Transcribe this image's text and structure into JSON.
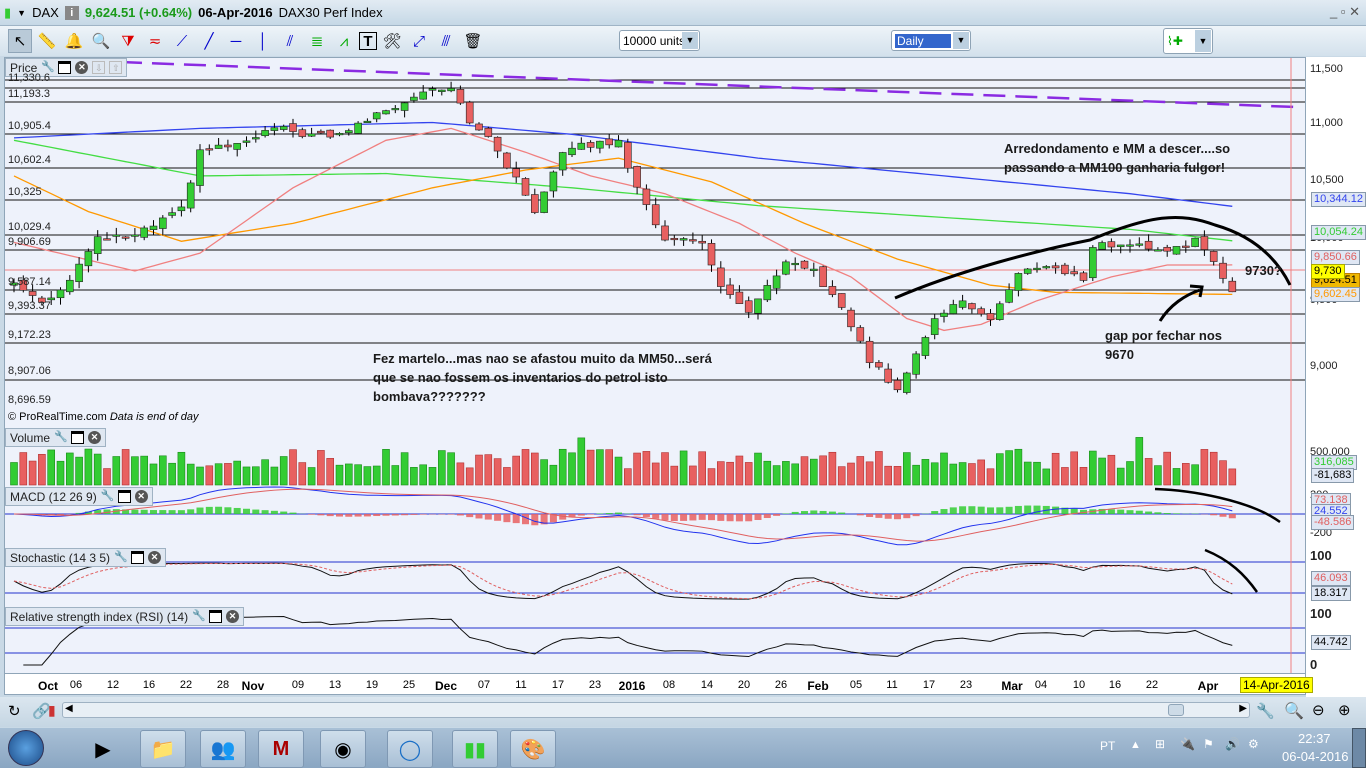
{
  "titlebar": {
    "symbol": "DAX",
    "price_change": "9,624.51 (+0.64%)",
    "date": "06-Apr-2016",
    "instrument": "DAX30 Perf Index",
    "window_controls": [
      "minimize",
      "restore",
      "close"
    ]
  },
  "toolbar": {
    "units": "10000 units",
    "timeframe": "Daily",
    "tools": [
      "pointer-icon",
      "ruler-icon",
      "alarm-icon",
      "zoom-icon",
      "triangle-pattern-icon",
      "channel-icon",
      "segment-icon",
      "line-icon",
      "horizontal-line-icon",
      "vertical-line-icon",
      "parallel-lines-icon",
      "fibonacci-icon",
      "trend-channel-icon",
      "text-icon",
      "tools-icon",
      "ray-icon",
      "parallel-ray-icon",
      "trash-icon"
    ]
  },
  "panes": {
    "price": {
      "label": "Price",
      "levels": [
        "11,330.6",
        "11,193.3",
        "10,905.4",
        "10,602.4",
        "10,325",
        "10,029.4",
        "9,906.69",
        "9,587.14",
        "9,393.37",
        "9,172.23",
        "8,907.06",
        "8,696.59"
      ],
      "axis": [
        "11,500",
        "11,000",
        "10,500",
        "10,000",
        "9,500",
        "9,000"
      ],
      "tags": {
        "ma200": "10,344.12",
        "ma100": "10,054.24",
        "ma20": "9,850.66",
        "level": "9,730",
        "last": "9,624.51",
        "ma50": "9,602.45"
      },
      "copyright": "© ProRealTime.com",
      "eod": "Data is end of day"
    },
    "volume": {
      "label": "Volume",
      "axis": "500,000",
      "tags": [
        "316,085",
        "-81,683"
      ]
    },
    "macd": {
      "label": "MACD (12 26 9)",
      "axis": [
        "200",
        "-200"
      ],
      "tags": [
        "73.138",
        "24.552",
        "-48.586"
      ]
    },
    "stochastic": {
      "label": "Stochastic (14 3 5)",
      "axis": [
        "100"
      ],
      "tags": [
        "46.093",
        "18.317"
      ]
    },
    "rsi": {
      "label": "Relative strength index (RSI) (14)",
      "axis": [
        "100",
        "0"
      ],
      "tags": [
        "44.742"
      ]
    }
  },
  "annotations": {
    "note1": [
      "Arredondamento e MM a descer....so",
      "passando a MM100 ganharia fulgor!"
    ],
    "note2": [
      "Fez martelo...mas nao se afastou muito da MM50...será",
      "que se nao fossem os inventarios do petrol isto",
      "bombava???????"
    ],
    "note3": [
      "gap por fechar nos",
      "9670"
    ],
    "note4": "9730?"
  },
  "xaxis": {
    "labels": [
      "Oct",
      "06",
      "12",
      "16",
      "22",
      "28",
      "Nov",
      "09",
      "13",
      "19",
      "25",
      "Dec",
      "07",
      "11",
      "17",
      "23",
      "2016",
      "08",
      "14",
      "20",
      "26",
      "Feb",
      "05",
      "11",
      "17",
      "23",
      "Mar",
      "04",
      "10",
      "16",
      "22",
      "Apr"
    ],
    "cursor_date": "14-Apr-2016"
  },
  "taskbar": {
    "lang": "PT",
    "time": "22:37",
    "date": "06-04-2016"
  },
  "colors": {
    "up": "#33cc33",
    "down": "#e86060",
    "ma20": "#f08080",
    "ma50": "#ff9900",
    "ma100": "#44dd44",
    "ma200": "#3344ee",
    "trend": "#8a2be2"
  },
  "chart_data": {
    "type": "candlestick",
    "title": "DAX30 Perf Index Daily",
    "bars": 132,
    "close_keypoints": [
      [
        0,
        9700
      ],
      [
        1,
        9640
      ],
      [
        3,
        9555
      ],
      [
        5,
        9640
      ],
      [
        9,
        10060
      ],
      [
        13,
        10090
      ],
      [
        18,
        10310
      ],
      [
        20,
        10820
      ],
      [
        24,
        10860
      ],
      [
        28,
        11000
      ],
      [
        34,
        10920
      ],
      [
        40,
        11150
      ],
      [
        44,
        11320
      ],
      [
        47,
        11360
      ],
      [
        49,
        11070
      ],
      [
        52,
        10820
      ],
      [
        56,
        10310
      ],
      [
        59,
        10820
      ],
      [
        65,
        10900
      ],
      [
        67,
        10480
      ],
      [
        70,
        10060
      ],
      [
        74,
        10060
      ],
      [
        76,
        9640
      ],
      [
        79,
        9470
      ],
      [
        83,
        9850
      ],
      [
        86,
        9810
      ],
      [
        89,
        9470
      ],
      [
        92,
        9050
      ],
      [
        95,
        8800
      ],
      [
        96,
        8970
      ],
      [
        99,
        9390
      ],
      [
        102,
        9555
      ],
      [
        105,
        9390
      ],
      [
        108,
        9770
      ],
      [
        111,
        9850
      ],
      [
        115,
        9720
      ],
      [
        116,
        10020
      ],
      [
        120,
        10020
      ],
      [
        124,
        9980
      ],
      [
        127,
        10060
      ],
      [
        129,
        9850
      ],
      [
        131,
        9624.51
      ]
    ],
    "ma20": [
      [
        0,
        10040
      ],
      [
        13,
        9800
      ],
      [
        20,
        9950
      ],
      [
        30,
        10500
      ],
      [
        40,
        10900
      ],
      [
        47,
        11000
      ],
      [
        55,
        10800
      ],
      [
        62,
        10600
      ],
      [
        70,
        10450
      ],
      [
        78,
        10200
      ],
      [
        84,
        9950
      ],
      [
        90,
        9750
      ],
      [
        96,
        9400
      ],
      [
        100,
        9300
      ],
      [
        104,
        9350
      ],
      [
        110,
        9550
      ],
      [
        118,
        9750
      ],
      [
        124,
        9850
      ],
      [
        131,
        9850.66
      ]
    ],
    "ma50": [
      [
        0,
        10600
      ],
      [
        8,
        10300
      ],
      [
        18,
        10050
      ],
      [
        30,
        10200
      ],
      [
        45,
        10500
      ],
      [
        55,
        10650
      ],
      [
        65,
        10750
      ],
      [
        75,
        10550
      ],
      [
        85,
        10200
      ],
      [
        95,
        9900
      ],
      [
        105,
        9680
      ],
      [
        112,
        9620
      ],
      [
        131,
        9602.45
      ]
    ],
    "ma100": [
      [
        0,
        10900
      ],
      [
        10,
        10750
      ],
      [
        20,
        10600
      ],
      [
        40,
        10620
      ],
      [
        60,
        10500
      ],
      [
        80,
        10350
      ],
      [
        100,
        10250
      ],
      [
        120,
        10150
      ],
      [
        131,
        10054.24
      ]
    ],
    "ma200": [
      [
        0,
        10920
      ],
      [
        20,
        11000
      ],
      [
        45,
        11050
      ],
      [
        60,
        10950
      ],
      [
        80,
        10750
      ],
      [
        100,
        10600
      ],
      [
        120,
        10450
      ],
      [
        131,
        10344.12
      ]
    ],
    "ylim": [
      8650,
      11600
    ]
  }
}
